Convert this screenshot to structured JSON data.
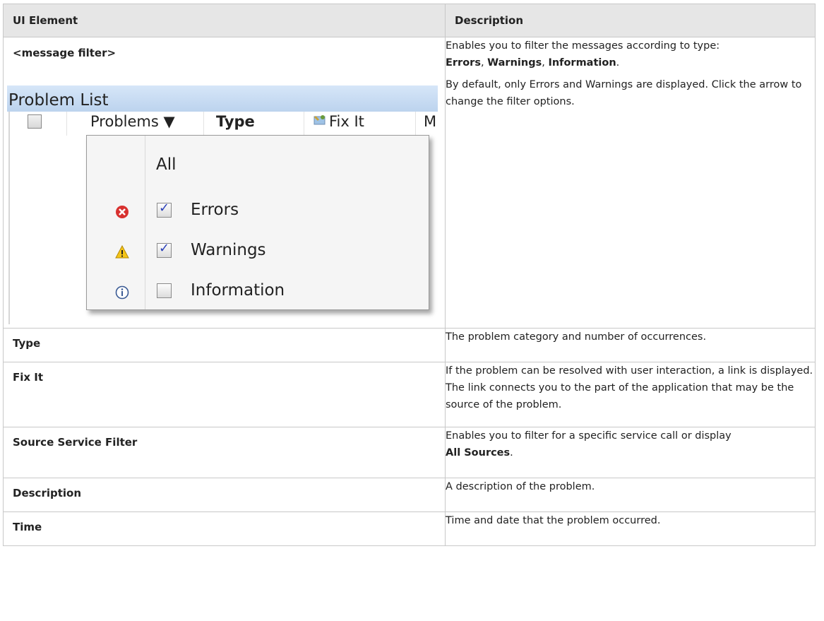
{
  "table": {
    "headers": [
      "UI Element",
      "Description"
    ],
    "rows": [
      {
        "element": "<message filter>",
        "desc_p1_prefix": "Enables you to filter the messages according to type:",
        "desc_p1_errors": "Errors",
        "desc_p1_sep1": ", ",
        "desc_p1_warnings": "Warnings",
        "desc_p1_sep2": ", ",
        "desc_p1_info": "Information",
        "desc_p1_end": ".",
        "desc_p2": "By default, only Errors and Warnings are displayed. Click the arrow to change the filter options."
      },
      {
        "element": "Type",
        "desc": "The problem category and number of occurrences."
      },
      {
        "element": "Fix It",
        "desc": "If the problem can be resolved with user interaction, a link is displayed. The link connects you to the part of the application that may be the source of the problem."
      },
      {
        "element": "Source Service Filter",
        "desc_prefix": "Enables you to filter for a specific service call or display ",
        "desc_bold": "All Sources",
        "desc_end": "."
      },
      {
        "element": "Description",
        "desc": "A description of the problem."
      },
      {
        "element": "Time",
        "desc": "Time and date that the problem occurred."
      }
    ]
  },
  "screenshot": {
    "panel_title": "Problem List",
    "columns": [
      "Problems ▼",
      "Type",
      "Fix It",
      "M"
    ],
    "menu": {
      "all_label": "All",
      "items": [
        {
          "label": "Errors",
          "checked": true,
          "icon": "error-icon"
        },
        {
          "label": "Warnings",
          "checked": true,
          "icon": "warning-icon"
        },
        {
          "label": "Information",
          "checked": false,
          "icon": "info-icon"
        }
      ]
    }
  },
  "colors": {
    "header_bg": "#e6e6e6",
    "border": "#c8c8c8",
    "panel_bar": "#c9dcf3"
  }
}
